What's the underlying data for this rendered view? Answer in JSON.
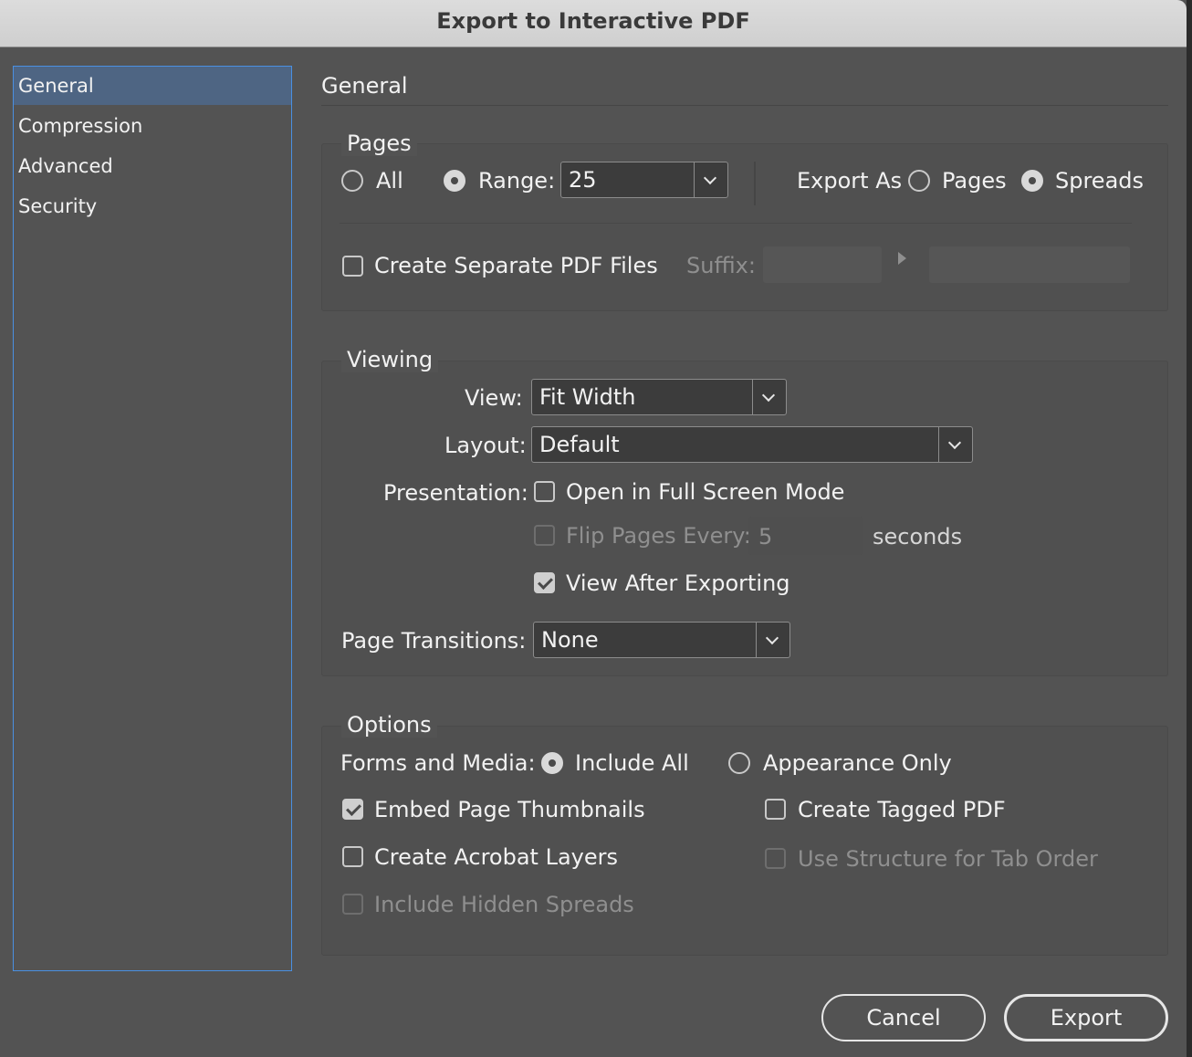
{
  "window": {
    "title": "Export to Interactive PDF"
  },
  "sidebar": {
    "items": [
      {
        "label": "General",
        "selected": true
      },
      {
        "label": "Compression",
        "selected": false
      },
      {
        "label": "Advanced",
        "selected": false
      },
      {
        "label": "Security",
        "selected": false
      }
    ]
  },
  "main": {
    "section_title": "General"
  },
  "pages": {
    "legend": "Pages",
    "all_label": "All",
    "range_label": "Range:",
    "range_value": "25",
    "export_as_label": "Export As",
    "pages_label": "Pages",
    "spreads_label": "Spreads",
    "selected_range": "range",
    "selected_export_as": "spreads",
    "separate_files_label": "Create Separate PDF Files",
    "separate_files_checked": false,
    "suffix_label": "Suffix:"
  },
  "viewing": {
    "legend": "Viewing",
    "view_label": "View:",
    "view_value": "Fit Width",
    "layout_label": "Layout:",
    "layout_value": "Default",
    "presentation_label": "Presentation:",
    "full_screen_label": "Open in Full Screen Mode",
    "full_screen_checked": false,
    "flip_label": "Flip Pages Every:",
    "flip_value": "5",
    "seconds_label": "seconds",
    "view_after_label": "View After Exporting",
    "view_after_checked": true,
    "transitions_label": "Page Transitions:",
    "transitions_value": "None"
  },
  "options": {
    "legend": "Options",
    "forms_label": "Forms and Media:",
    "include_all_label": "Include All",
    "appearance_only_label": "Appearance Only",
    "forms_selected": "include_all",
    "embed_thumbnails_label": "Embed Page Thumbnails",
    "embed_thumbnails_checked": true,
    "tagged_pdf_label": "Create Tagged PDF",
    "tagged_pdf_checked": false,
    "acrobat_layers_label": "Create Acrobat Layers",
    "acrobat_layers_checked": false,
    "tab_order_label": "Use Structure for Tab Order",
    "tab_order_checked": false,
    "hidden_spreads_label": "Include Hidden Spreads",
    "hidden_spreads_checked": false
  },
  "buttons": {
    "cancel": "Cancel",
    "export": "Export"
  },
  "colors": {
    "background": "#535353",
    "selection": "#4e6583",
    "focus_ring": "#4a90e2",
    "titlebar": "#d6d6d6"
  }
}
